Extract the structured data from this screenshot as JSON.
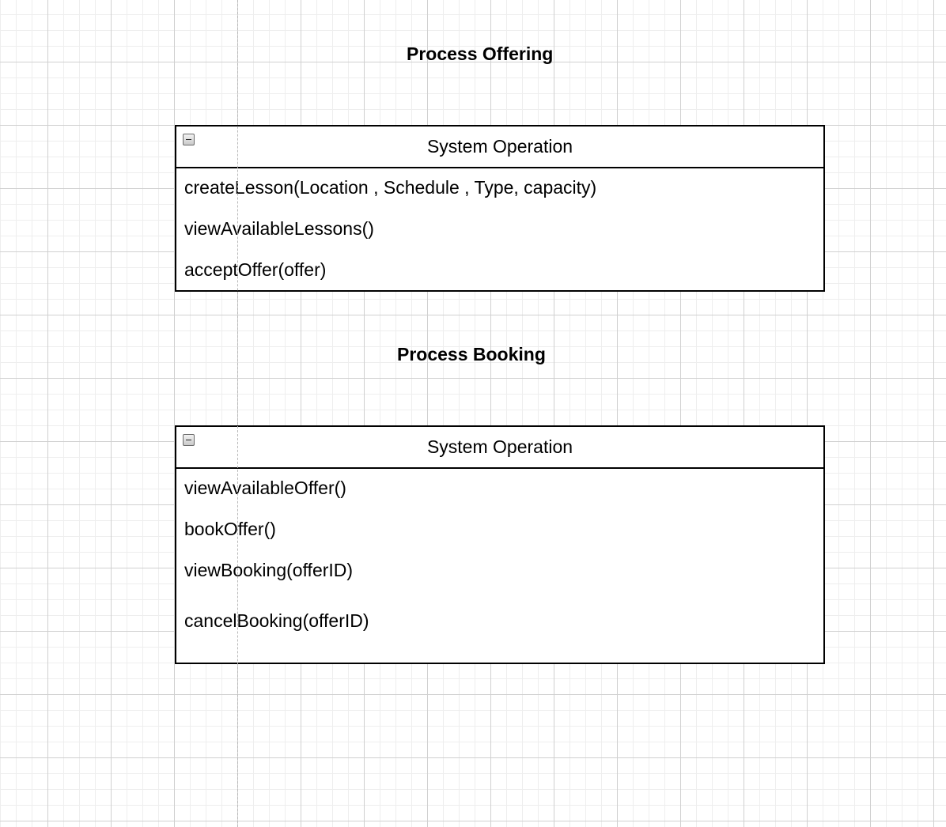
{
  "diagram": {
    "offering": {
      "title": "Process Offering",
      "header": "System Operation",
      "operations": [
        "createLesson(Location , Schedule , Type, capacity)",
        "viewAvailableLessons()",
        "acceptOffer(offer)"
      ]
    },
    "booking": {
      "title": "Process Booking",
      "header": "System Operation",
      "operations": [
        "viewAvailableOffer()",
        "bookOffer()",
        "viewBooking(offerID)",
        "cancelBooking(offerID)"
      ]
    }
  }
}
